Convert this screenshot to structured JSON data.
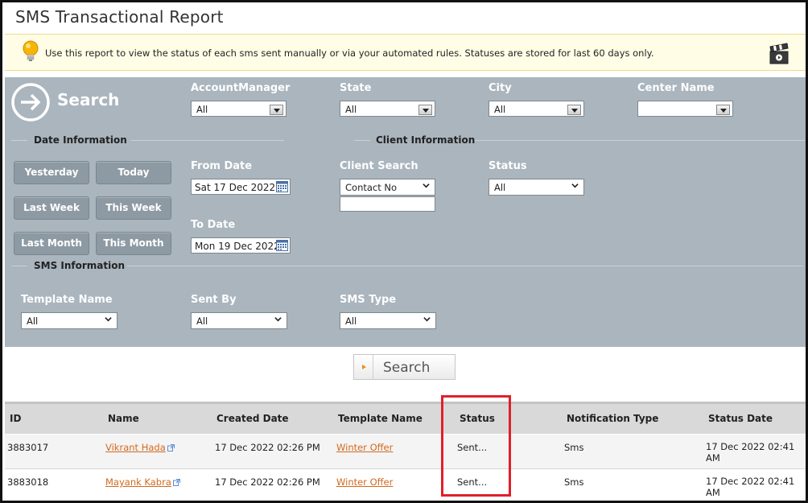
{
  "page": {
    "title": "SMS Transactional Report"
  },
  "info": {
    "text": "Use this report to view the status of each sms sent manually or via your automated rules. Statuses are stored for last 60 days only."
  },
  "search_panel": {
    "heading": "Search",
    "filters": [
      {
        "label": "AccountManager",
        "value": "All"
      },
      {
        "label": "State",
        "value": "All"
      },
      {
        "label": "City",
        "value": "All"
      },
      {
        "label": "Center Name",
        "value": ""
      }
    ],
    "date_section": {
      "title": "Date Information",
      "quick_buttons": [
        "Yesterday",
        "Today",
        "Last Week",
        "This Week",
        "Last Month",
        "This Month"
      ],
      "from_label": "From Date",
      "from_value": "Sat 17 Dec 2022",
      "to_label": "To Date",
      "to_value": "Mon 19 Dec 2022"
    },
    "client_section": {
      "title": "Client Information",
      "search_label": "Client Search",
      "search_type": "Contact No",
      "search_value": "",
      "status_label": "Status",
      "status_value": "All"
    },
    "sms_section": {
      "title": "SMS Information",
      "template_label": "Template Name",
      "template_value": "All",
      "sentby_label": "Sent By",
      "sentby_value": "All",
      "type_label": "SMS Type",
      "type_value": "All"
    },
    "submit_label": "Search"
  },
  "table": {
    "headers": [
      "ID",
      "Name",
      "Created Date",
      "Template Name",
      "Status",
      "Notification Type",
      "Status Date"
    ],
    "rows": [
      {
        "id": "3883017",
        "name": "Vikrant Hada",
        "created": "17 Dec 2022 02:26 PM",
        "template": "Winter Offer",
        "status": "Sent...",
        "notification": "Sms",
        "status_date_1": "17 Dec 2022 02:41",
        "status_date_2": "AM"
      },
      {
        "id": "3883018",
        "name": "Mayank Kabra",
        "created": "17 Dec 2022 02:26 PM",
        "template": "Winter Offer",
        "status": "Sent...",
        "notification": "Sms",
        "status_date_1": "17 Dec 2022 02:41",
        "status_date_2": "AM"
      }
    ]
  },
  "colors": {
    "panel": "#aab5be",
    "accent": "#d2691e",
    "highlight": "#e0202a",
    "info_bg": "#fffde6"
  }
}
